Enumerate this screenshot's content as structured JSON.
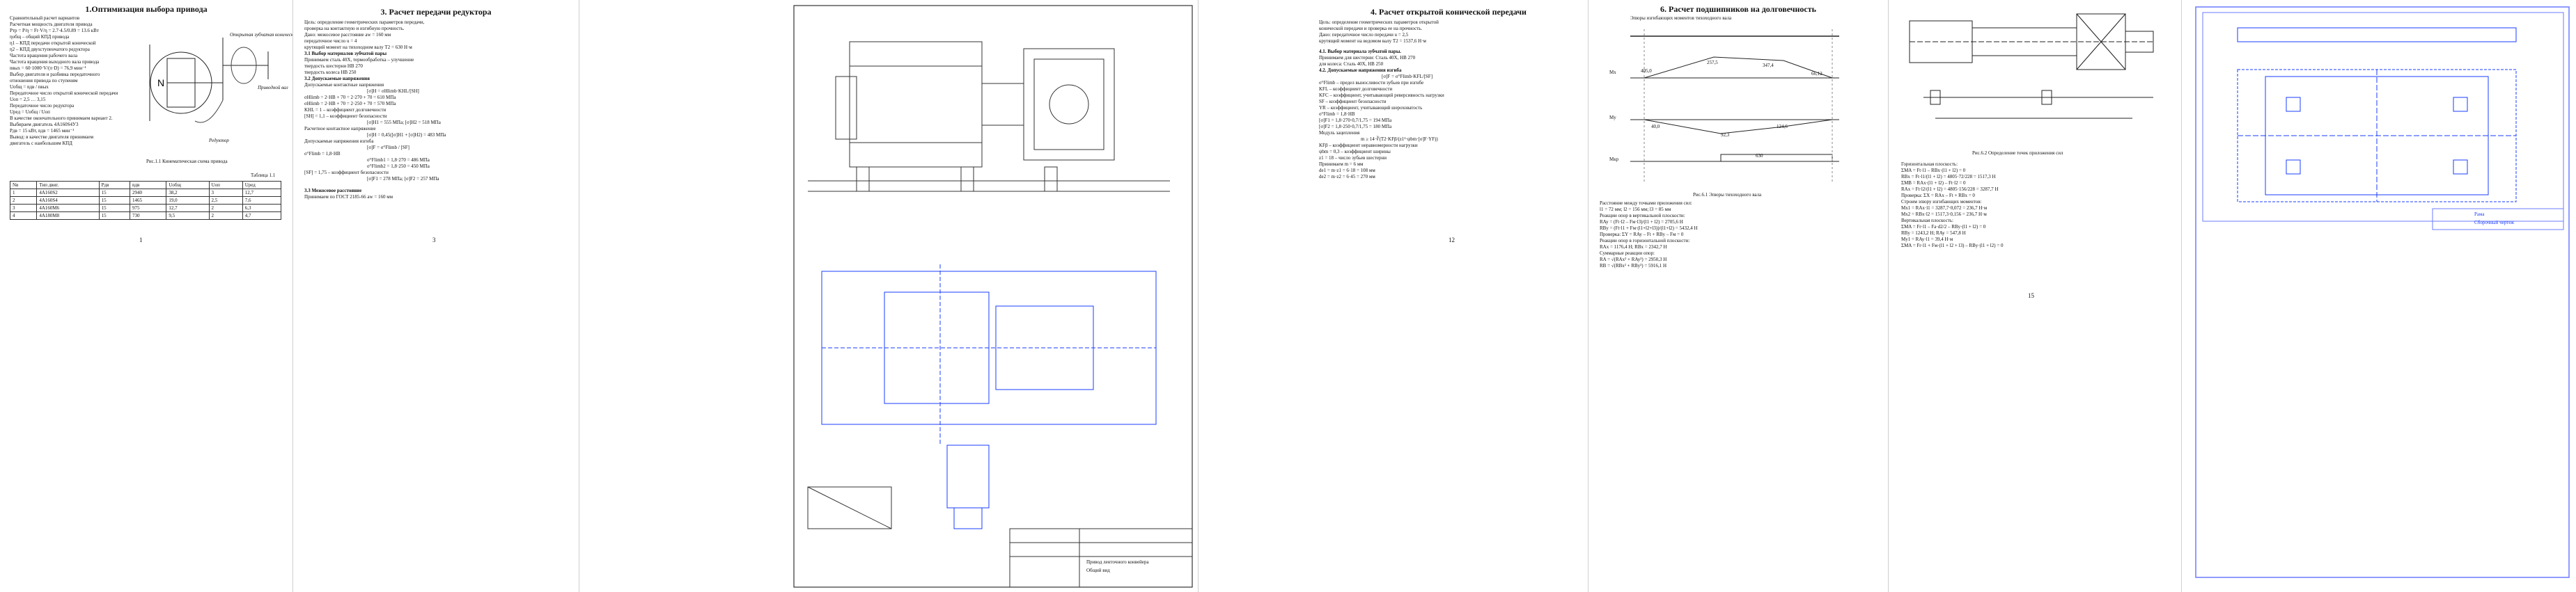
{
  "page1": {
    "title": "1.Оптимизация выбора привода",
    "lines": [
      "Сравнительный расчет вариантов",
      "Расчетная мощность двигателя привода",
      "Pтр = P/η = Ft·V/η = 2.7·4.5/0.89 = 13.6 кВт",
      "ηобщ – общий КПД привода",
      "η1 – КПД передачи открытой конической",
      "η2 – КПД двухступенчатого редуктора",
      "Частота вращения рабочего вала",
      "Частота вращения выходного вала привода",
      "nвых = 60·1000·V/(π·D) = 76,9 мин⁻¹",
      "Выбор двигателя и разбивка передаточного",
      "отношения привода по ступеням",
      "Uобщ = nдв / nвых",
      "Передаточное число открытой конической передачи",
      "Uоп = 2,5 … 3,15",
      "Передаточное число редуктора",
      "Uред = Uобщ / Uоп",
      "В качестве окончательного принимаем вариант 2.",
      "Выбираем двигатель 4А160S4У3",
      "Pдв = 15 кВт, nдв = 1465 мин⁻¹",
      "Вывод: в качестве двигателя принимаем",
      "двигатель с наибольшим КПД"
    ],
    "figure_labels": {
      "top": "Открытая зубчатая коническая передача",
      "right": "Приводной вал",
      "bottom": "Редуктор"
    },
    "caption": "Рис.1.1 Кинематическая схема привода",
    "table_title": "Таблица 1.1",
    "table_rows": [
      [
        "Nв",
        "Тип двиг.",
        "Pдв",
        "nдв",
        "Uобщ",
        "Uоп",
        "Uред"
      ],
      [
        "1",
        "4А160S2",
        "15",
        "2940",
        "38,2",
        "3",
        "12,7"
      ],
      [
        "2",
        "4А160S4",
        "15",
        "1465",
        "19,0",
        "2,5",
        "7,6"
      ],
      [
        "3",
        "4А160M6",
        "15",
        "975",
        "12,7",
        "2",
        "6,3"
      ],
      [
        "4",
        "4А180M8",
        "15",
        "730",
        "9,5",
        "2",
        "4,7"
      ]
    ],
    "page_number": "1"
  },
  "page2": {
    "title": "3. Расчет передачи редуктора",
    "lines": [
      "Цель: определение геометрических параметров передачи,",
      "проверка на контактную и изгибную прочность.",
      "Дано: межосевое расстояние aw = 160 мм",
      "передаточное число u = 4",
      "крутящий момент на тихоходном валу T2 = 630 Н·м",
      "3.1    Выбор материалов зубчатой пары",
      "Принимаем сталь 40Х, термообработка – улучшение",
      "твердость шестерни HB 270",
      "твердость колеса HB 250",
      "3.2    Допускаемые напряжения",
      "Допускаемые контактные напряжения",
      "[σ]H = σHlimb·KHL/[SH]",
      "σHlimb = 2·HB + 70 = 2·270 + 70 = 610 МПа",
      "σHlimb = 2·HB + 70 = 2·250 + 70 = 570 МПа",
      "KHL = 1 – коэффициент долговечности",
      "[SH] = 1,1 – коэффициент безопасности",
      "[σ]H1 = 555 МПа; [σ]H2 = 518 МПа",
      "Расчетное контактное напряжение",
      "[σ]H = 0,45([σ]H1 + [σ]H2) = 483 МПа",
      "Допускаемые напряжения изгиба",
      "[σ]F = σ°Flimb / [SF]",
      "σ°Flimb = 1,8·HB",
      "σ°Flimb1 = 1,8·270 = 486 МПа",
      "σ°Flimb2 = 1,8·250 = 450 МПа",
      "[SF] = 1,75 – коэффициент безопасности",
      "[σ]F1 = 278 МПа; [σ]F2 = 257 МПа",
      "3.3    Межосевое расстояние",
      "Принимаем по ГОСТ 2185-66 aw = 160 мм"
    ],
    "page_number": "3"
  },
  "drawing1": {
    "stamp_lines": [
      "Привод ленточного конвейера",
      "Общий вид"
    ]
  },
  "page3": {
    "title": "4. Расчет открытой конической передачи",
    "lines": [
      "Цель: определение геометрических параметров открытой",
      "конической передачи и проверка ее на прочность.",
      "Дано: передаточное число передачи u = 2,5",
      "крутящий момент на ведомом валу T2 = 1537,6 Н·м",
      "4.1. Выбор материала зубчатой пары.",
      "Принимаем для шестерни: Сталь 40Х, HB 270",
      "для колеса: Сталь 40Х, HB 250",
      "4.2. Допускаемые напряжения изгиба",
      "[σ]F = σ°Flimb·KFL/[SF]",
      "σ°Flimb – предел выносливости зубьев при изгибе",
      "KFL – коэффициент долговечности",
      "KFC – коэффициент, учитывающий реверсивность нагрузки",
      "SF – коэффициент безопасности",
      "YR – коэффициент, учитывающий шероховатость",
      "σ°Flimb = 1,8·HB",
      "[σ]F1 = 1,8·270·0,7/1,75 = 194 МПа",
      "[σ]F2 = 1,8·250·0,7/1,75 = 180 МПа",
      "Модуль зацепления",
      "m ≥ 14·∛(T2·KFβ/(z1²·ψbm·[σ]F·YF))",
      "KFβ – коэффициент неравномерности нагрузки",
      "ψbm = 0,3 – коэффициент ширины",
      "z1 = 18 – число зубьев шестерни",
      "Принимаем m = 6 мм",
      "dе1 = m·z1 = 6·18 = 108 мм",
      "dе2 = m·z2 = 6·45 = 270 мм"
    ],
    "page_number": "12"
  },
  "page4": {
    "title": "6. Расчет подшипников на долговечность",
    "diagram_title": "Эпюры изгибающих моментов тихоходного вала",
    "moment_labels": [
      "Mx",
      "My",
      "Mкр"
    ],
    "values": [
      "405,0",
      "257,5",
      "347,4",
      "66,12",
      "92,3",
      "124,6",
      "40,0",
      "630"
    ],
    "caption": "Рис.6.1 Эпюры тихоходного вала",
    "lines": [
      "Расстояние между точками приложения сил:",
      "l1 = 72 мм; l2 = 156 мм; l3 = 85 мм",
      "Реакции опор в вертикальной плоскости:",
      "RAy = (Ft·l2 – Fм·l3)/(l1 + l2) = 2705,6 Н",
      "RBy = (Ft·l1 + Fм·(l1+l2+l3))/(l1+l2) = 5432,4 Н",
      "Проверка: ΣY = RAy – Ft + RBy – Fм = 0",
      "Реакции опор в горизонтальной плоскости:",
      "RAx = 1176,4 Н; RBx = 2342,7 Н",
      "Суммарные реакции опор:",
      "RA = √(RAx² + RAy²) = 2950,3 Н",
      "RB = √(RBx² + RBy²) = 5916,1 Н"
    ],
    "page_number": "14"
  },
  "page5": {
    "caption": "Рис.6.2 Определение точек приложения сил",
    "lines": [
      "Горизонтальная плоскость:",
      "ΣMA = Ft·l1 – RBx·(l1 + l2) = 0",
      "RBx = Ft·l1/(l1 + l2) = 4805·72/228 = 1517,3 Н",
      "ΣMB = RAx·(l1 + l2) – Ft·l2 = 0",
      "RAx = Ft·l2/(l1 + l2) = 4805·156/228 = 3287,7 Н",
      "Проверка: ΣX = RAx – Ft + RBx = 0",
      "Строим эпюру изгибающих моментов:",
      "Mx1 = RAx·l1 = 3287,7·0,072 = 236,7 Н·м",
      "Mx2 = RBx·l2 = 1517,3·0,156 = 236,7 Н·м",
      "Вертикальная плоскость:",
      "ΣMA = Fr·l1 – Fa·d2/2 – RBy·(l1 + l2) = 0",
      "RBy = 1243,2 Н; RAy = 547,8 Н",
      "My1 = RAy·l1 = 39,4 Н·м",
      "ΣMA = Fr·l1 + Fм·(l1 + l2 + l3) – RBy·(l1 + l2) = 0"
    ],
    "page_number": "15"
  },
  "drawing2": {
    "stamp_lines": [
      "Рама",
      "Сборочный чертеж"
    ]
  },
  "colors": {
    "drawing_blue": "#1a3cff",
    "drawing_border": "#6b7bff"
  }
}
